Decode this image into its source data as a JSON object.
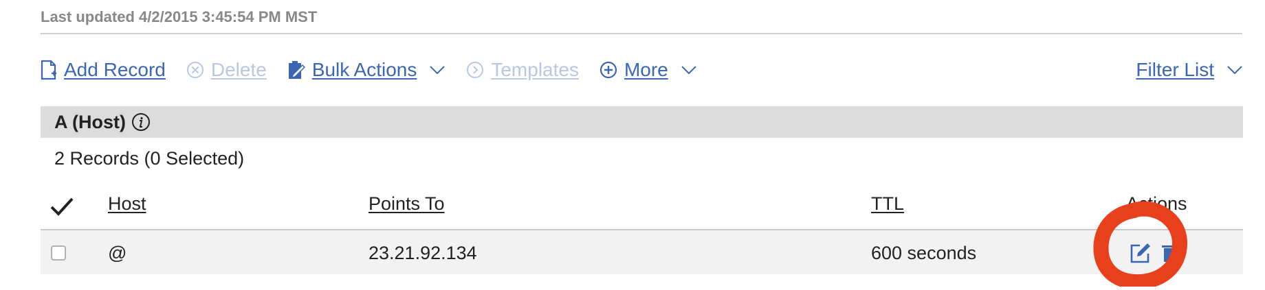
{
  "header": {
    "last_updated": "Last updated 4/2/2015 3:45:54 PM MST"
  },
  "toolbar": {
    "add_record": "Add Record",
    "delete": "Delete",
    "bulk_actions": "Bulk Actions",
    "templates": "Templates",
    "more": "More",
    "filter_list": "Filter List"
  },
  "section": {
    "title": "A (Host)",
    "records_count": "2 Records (0 Selected)"
  },
  "table": {
    "columns": {
      "host": "Host",
      "points_to": "Points To",
      "ttl": "TTL",
      "actions": "Actions"
    },
    "rows": [
      {
        "host": "@",
        "points_to": "23.21.92.134",
        "ttl": "600 seconds"
      }
    ]
  },
  "colors": {
    "link": "#3a66b3",
    "link_disabled": "#b9c7e2",
    "section_bg": "#dcdcdc",
    "row_bg": "#f2f2f2",
    "annotation": "#e8401c"
  },
  "icons": [
    "add-record-icon",
    "delete-icon",
    "bulk-actions-icon",
    "templates-icon",
    "more-icon",
    "chevron-down-icon",
    "info-icon",
    "checkmark-icon",
    "edit-icon",
    "delete-record-icon"
  ]
}
